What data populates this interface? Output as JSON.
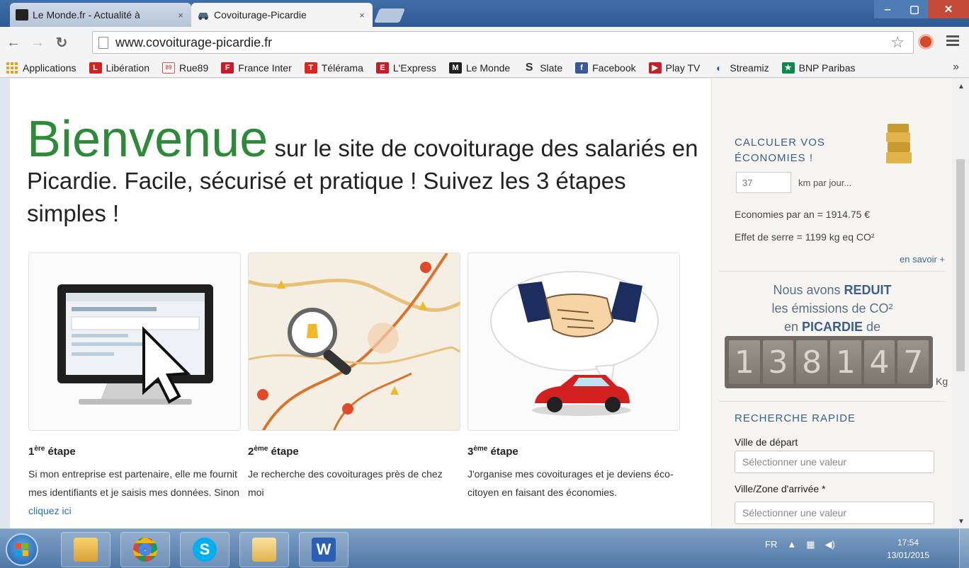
{
  "browser": {
    "tabs": [
      {
        "label": "Le Monde.fr - Actualité à",
        "close": "×",
        "favicon_color": "#222222"
      },
      {
        "label": "Covoiturage-Picardie",
        "close": "×",
        "favicon_color": "#4a6d8c"
      }
    ],
    "url": "www.covoiturage-picardie.fr",
    "window_controls": {
      "minimize": "‒",
      "maximize": "▢",
      "close": "✕"
    }
  },
  "bookmarks": [
    {
      "label": "Applications",
      "icon": "apps-icon",
      "color": "#e6a020"
    },
    {
      "label": "Libération",
      "icon": "liberation-icon",
      "color": "#d0231f"
    },
    {
      "label": "Rue89",
      "icon": "rue89-icon",
      "color": "#e05050"
    },
    {
      "label": "France Inter",
      "icon": "france-inter-icon",
      "color": "#c41e2e"
    },
    {
      "label": "Télérama",
      "icon": "telerama-icon",
      "color": "#d8281e"
    },
    {
      "label": "L'Express",
      "icon": "express-icon",
      "color": "#c0202a"
    },
    {
      "label": "Le Monde",
      "icon": "le-monde-icon",
      "color": "#222222"
    },
    {
      "label": "Slate",
      "icon": "slate-icon",
      "color": "#333333"
    },
    {
      "label": "Facebook",
      "icon": "facebook-icon",
      "color": "#3b5998"
    },
    {
      "label": "Play TV",
      "icon": "playtv-icon",
      "color": "#c8202a"
    },
    {
      "label": "Streamiz",
      "icon": "streamiz-icon",
      "color": "#2a5aa0"
    },
    {
      "label": "BNP Paribas",
      "icon": "bnp-icon",
      "color": "#0a8a4a"
    }
  ],
  "bookmarks_more": "»",
  "page": {
    "welcome_big": "Bienvenue",
    "welcome_rest": " sur le site de covoiturage des salariés en Picardie. Facile, sécurisé et pratique ! Suivez les 3 étapes simples !",
    "steps": [
      {
        "num": "1",
        "sup": "ère",
        "label": " étape",
        "desc": "Si mon entreprise est partenaire, elle me fournit mes identifiants et je saisis mes données. Sinon ",
        "link": "cliquez ici"
      },
      {
        "num": "2",
        "sup": "ème",
        "label": " étape",
        "desc": "Je recherche des covoiturages près de chez moi",
        "link": ""
      },
      {
        "num": "3",
        "sup": "ème",
        "label": " étape",
        "desc": "J'organise mes covoiturages et je deviens éco-citoyen en faisant des économies.",
        "link": ""
      }
    ]
  },
  "sidebar": {
    "calc_title": "Calculer vos économies !",
    "km_value": "37",
    "km_label": "km par jour...",
    "eco_year": "Economies par an = 1914.75 €",
    "greenhouse": "Effet de serre = 1199 kg eq CO²",
    "more_link": "en savoir +",
    "co2_line1_a": "Nous avons ",
    "co2_line1_b": "REDUIT",
    "co2_line2": "les émissions de CO²",
    "co2_line3_a": "en ",
    "co2_line3_b": "PICARDIE",
    "co2_line3_c": " de",
    "counter_digits": [
      "1",
      "3",
      "8",
      "1",
      "4",
      "7"
    ],
    "counter_unit": "Kg",
    "search_title": "RECHERCHE RAPIDE",
    "depart_label": "Ville de départ",
    "depart_placeholder": "Sélectionner une valeur",
    "arrival_label": "Ville/Zone d'arrivée *",
    "arrival_placeholder": "Sélectionner une valeur"
  },
  "taskbar": {
    "apps": [
      "explorer-icon",
      "chrome-icon",
      "skype-icon",
      "folder-icon",
      "word-icon"
    ],
    "tray_lang": "FR",
    "time": "17:54",
    "date": "13/01/2015"
  }
}
